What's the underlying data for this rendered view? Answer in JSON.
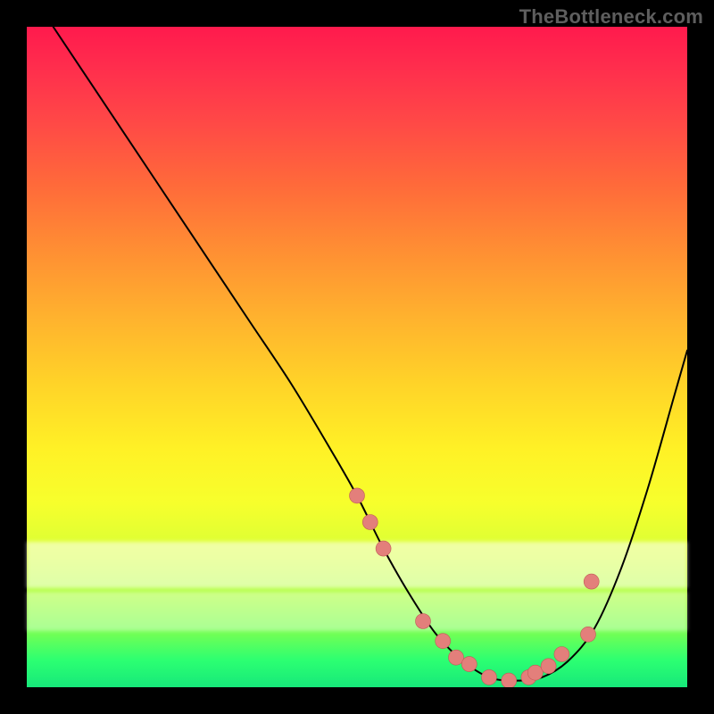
{
  "watermark": "TheBottleneck.com",
  "chart_data": {
    "type": "line",
    "title": "",
    "xlabel": "",
    "ylabel": "",
    "xlim": [
      0,
      100
    ],
    "ylim": [
      0,
      100
    ],
    "grid": false,
    "series": [
      {
        "name": "curve",
        "x": [
          4,
          10,
          16,
          22,
          28,
          34,
          40,
          46,
          50,
          54,
          58,
          62,
          66,
          70,
          74,
          78,
          82,
          86,
          90,
          94,
          98,
          100
        ],
        "values": [
          100,
          91,
          82,
          73,
          64,
          55,
          46,
          36,
          29,
          21,
          14,
          8,
          4,
          1.5,
          1,
          1.5,
          4,
          9,
          18,
          30,
          44,
          51
        ]
      }
    ],
    "scatter": {
      "name": "dots",
      "x": [
        50,
        52,
        54,
        60,
        63,
        65,
        67,
        70,
        73,
        76,
        77,
        79,
        81,
        85,
        85.5
      ],
      "values": [
        29,
        25,
        21,
        10,
        7,
        4.5,
        3.5,
        1.5,
        1,
        1.5,
        2.2,
        3.2,
        5,
        8,
        16
      ]
    }
  }
}
